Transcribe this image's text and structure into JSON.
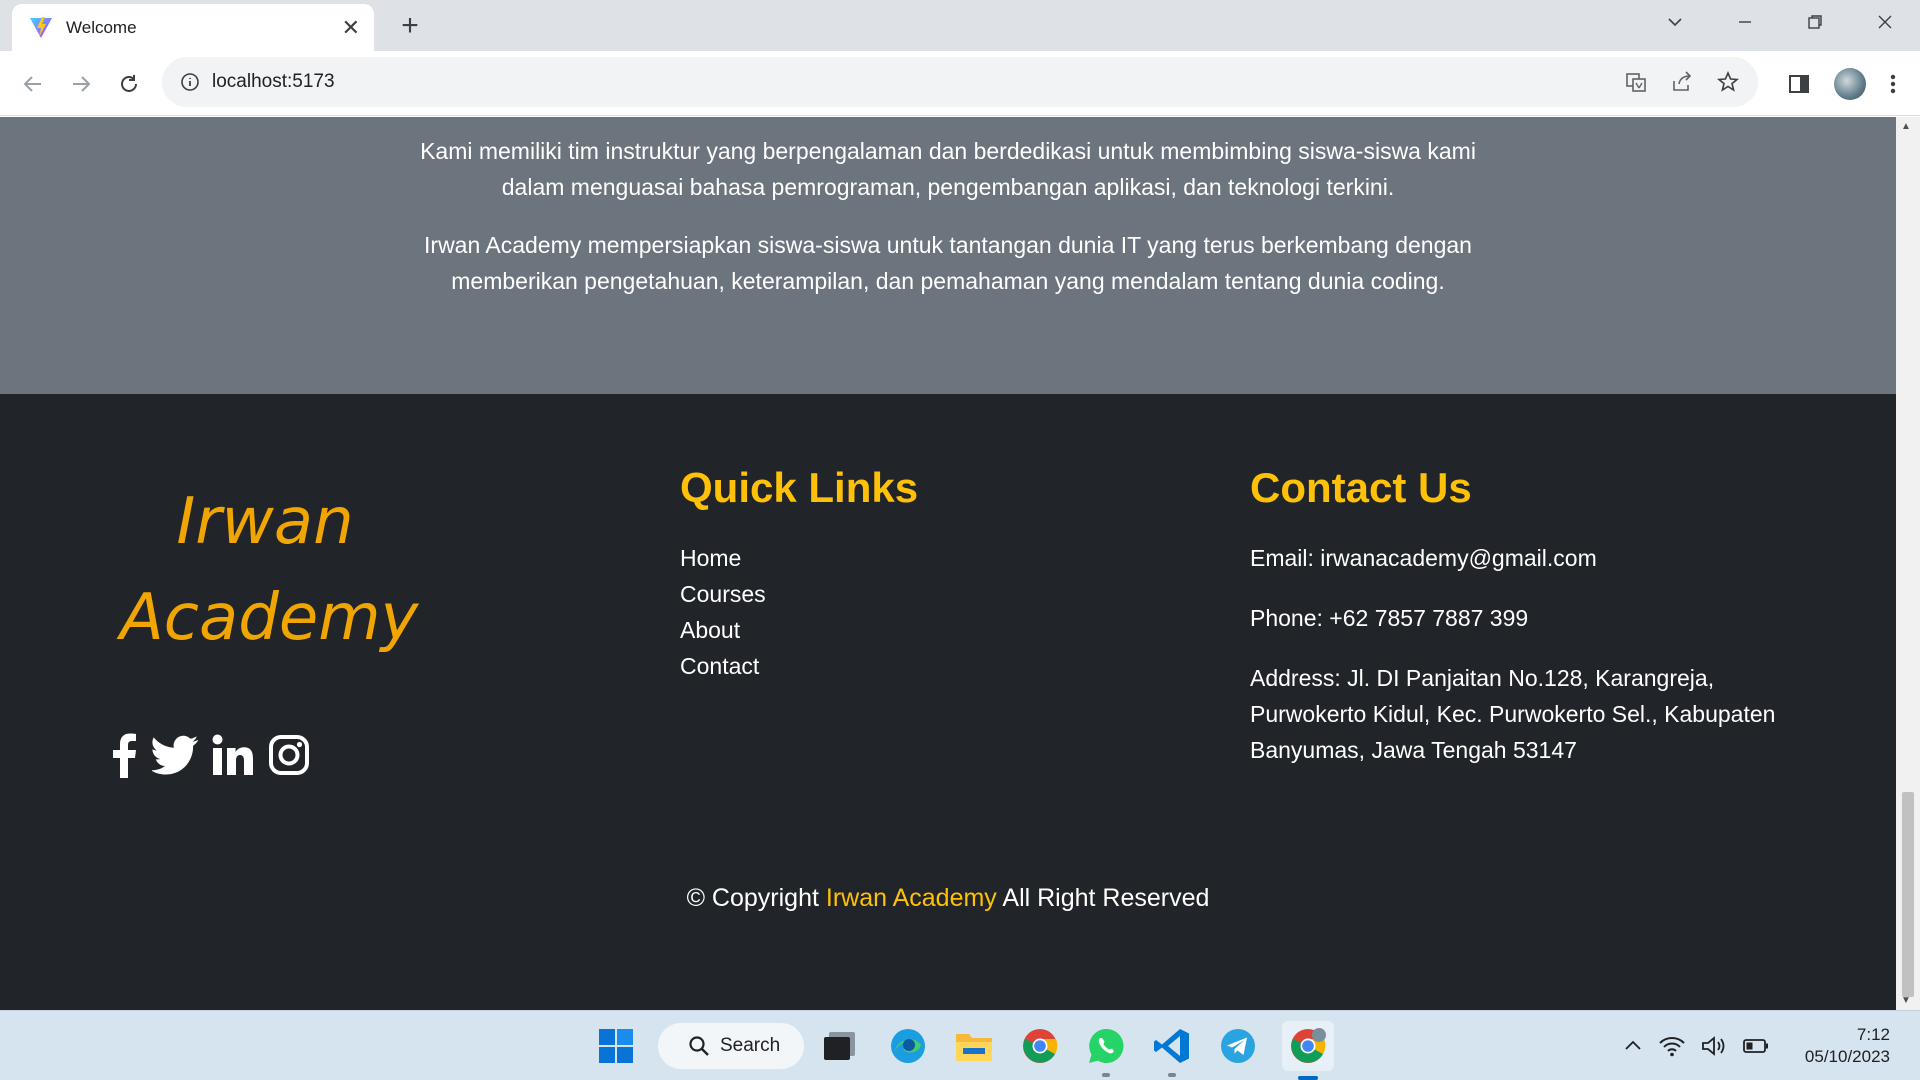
{
  "browser": {
    "tab_title": "Welcome",
    "url": "localhost:5173"
  },
  "page": {
    "about_paragraphs": [
      "Kami memiliki tim instruktur yang berpengalaman dan berdedikasi untuk membimbing siswa-siswa kami dalam menguasai bahasa pemrograman, pengembangan aplikasi, dan teknologi terkini.",
      "Irwan Academy mempersiapkan siswa-siswa untuk tantangan dunia IT yang terus berkembang dengan memberikan pengetahuan, keterampilan, dan pemahaman yang mendalam tentang dunia coding."
    ],
    "brand": {
      "line1": "Irwan",
      "line2": "Academy"
    },
    "socials": [
      "facebook-icon",
      "twitter-icon",
      "linkedin-icon",
      "instagram-icon"
    ],
    "quick_links": {
      "title": "Quick Links",
      "items": [
        "Home",
        "Courses",
        "About",
        "Contact"
      ]
    },
    "contact": {
      "title": "Contact Us",
      "email": "Email: irwanacademy@gmail.com",
      "phone": "Phone: +62 7857 7887 399",
      "address": "Address: Jl. DI Panjaitan No.128, Karangreja, Purwokerto Kidul, Kec. Purwokerto Sel., Kabupaten Banyumas, Jawa Tengah 53147"
    },
    "copyright": {
      "prefix": "© Copyright",
      "highlight": "Irwan Academy",
      "suffix": "All Right Reserved"
    }
  },
  "taskbar": {
    "search_label": "Search",
    "time": "7:12",
    "date": "05/10/2023"
  },
  "colors": {
    "about_bg": "#6c757d",
    "footer_bg": "#212529",
    "accent": "#ffc107",
    "brand": "#f0a500"
  }
}
